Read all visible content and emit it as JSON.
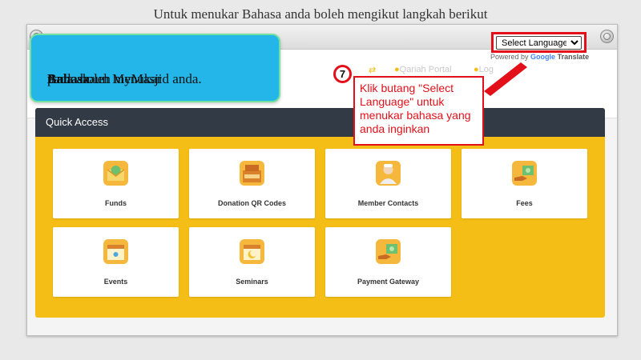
{
  "slide": {
    "title": "Untuk menukar Bahasa anda boleh mengikut langkah berikut"
  },
  "header": {
    "links": [
      "Qariah Portal",
      "Log"
    ],
    "language_select": {
      "selected": "Select Language"
    },
    "powered_by": "Powered by",
    "google": "Google",
    "translate": "Translate"
  },
  "quick_access": {
    "title": "Quick Access",
    "cards": [
      {
        "label": "Funds",
        "icon": "money-envelope-icon"
      },
      {
        "label": "Donation QR Codes",
        "icon": "infaq-box-icon"
      },
      {
        "label": "Member Contacts",
        "icon": "person-icon"
      },
      {
        "label": "Fees",
        "icon": "hand-money-icon"
      },
      {
        "label": "Events",
        "icon": "calendar-icon"
      },
      {
        "label": "Seminars",
        "icon": "crescent-calendar-icon"
      },
      {
        "label": "Payment Gateway",
        "icon": "hand-money-icon"
      }
    ]
  },
  "annotation": {
    "callout_text_before": "Anda boleh menukar ",
    "callout_bold": "Bahasa",
    "callout_text_after": " pada akaun MyMasjid anda.",
    "step_number": "7",
    "note": "Klik butang \"Select Language\" untuk menukar bahasa yang anda inginkan"
  },
  "colors": {
    "accent": "#F5BE16",
    "annotation_red": "#E3101A",
    "callout_blue": "#24B6E8",
    "header_dark": "#323A45"
  }
}
